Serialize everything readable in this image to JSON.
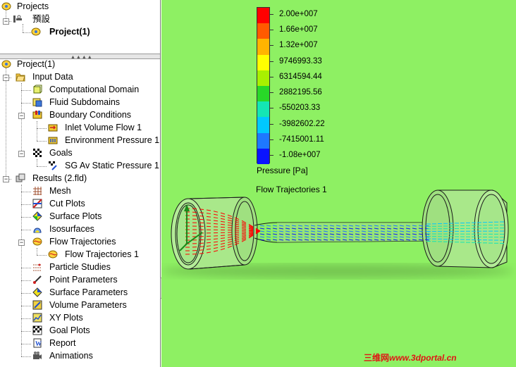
{
  "top_tree": {
    "root": "Projects",
    "config": "預設",
    "project": "Project(1)"
  },
  "bottom_tree": {
    "project": "Project(1)",
    "input_data": "Input Data",
    "computational_domain": "Computational Domain",
    "fluid_subdomains": "Fluid Subdomains",
    "boundary_conditions": "Boundary Conditions",
    "inlet_volume_flow": "Inlet Volume Flow 1",
    "environment_pressure": "Environment Pressure 1",
    "goals": "Goals",
    "sg_goal": "SG Av Static Pressure 1",
    "results": "Results (2.fld)",
    "mesh": "Mesh",
    "cut_plots": "Cut Plots",
    "surface_plots": "Surface Plots",
    "isosurfaces": "Isosurfaces",
    "flow_trajectories": "Flow Trajectories",
    "flow_trajectories_1": "Flow Trajectories 1",
    "particle_studies": "Particle Studies",
    "point_parameters": "Point Parameters",
    "surface_parameters": "Surface Parameters",
    "volume_parameters": "Volume Parameters",
    "xy_plots": "XY Plots",
    "goal_plots": "Goal Plots",
    "report": "Report",
    "animations": "Animations"
  },
  "legend": {
    "labels": [
      "2.00e+007",
      "1.66e+007",
      "1.32e+007",
      "9746993.33",
      "6314594.44",
      "2882195.56",
      "-550203.33",
      "-3982602.22",
      "-7415001.11",
      "-1.08e+007"
    ],
    "colors": [
      "#ff0000",
      "#ff5a00",
      "#ffb400",
      "#ffff00",
      "#a8f000",
      "#28d828",
      "#14e6b4",
      "#00c8ff",
      "#1e78ff",
      "#0a14ff"
    ],
    "title": "Pressure [Pa]"
  },
  "view": {
    "trajectory_title": "Flow Trajectories 1",
    "background": "#8ef063"
  },
  "watermark": {
    "cn": "三维网",
    "url": "www.3dportal.cn"
  }
}
